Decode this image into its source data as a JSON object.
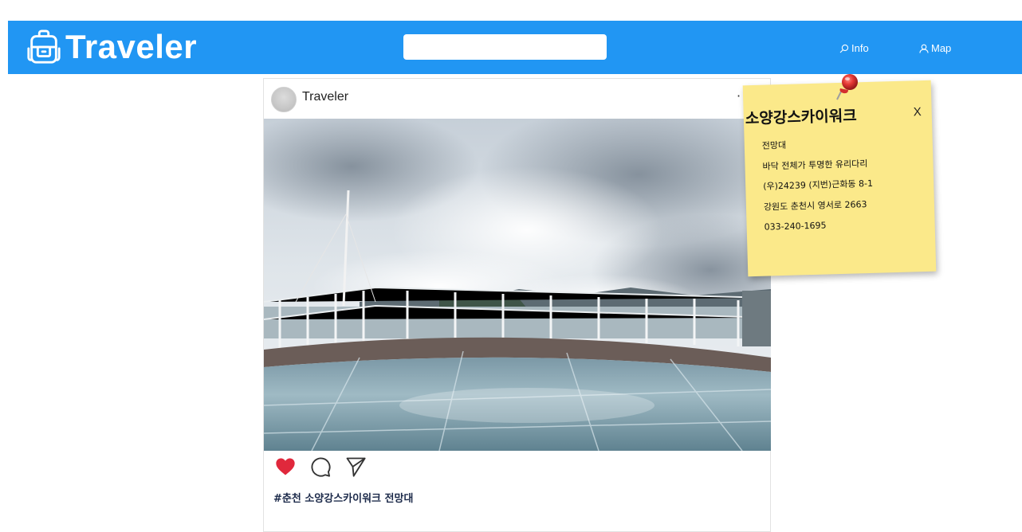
{
  "header": {
    "app_name": "Traveler",
    "search": {
      "value": "",
      "placeholder": ""
    },
    "nav": [
      {
        "label": "Info",
        "icon": "search-icon"
      },
      {
        "label": "Map",
        "icon": "person-icon"
      }
    ]
  },
  "post": {
    "username": "Traveler",
    "more_label": "·",
    "image_description_icon": "panorama-photo",
    "actions": [
      "heart-icon",
      "comment-icon",
      "send-icon"
    ],
    "caption": "#춘천 소양강스카이워크 전망대",
    "liked": true
  },
  "info_note": {
    "title": "소양강스카이워크",
    "close_label": "X",
    "lines": [
      "전망대",
      "바닥 전체가 투명한 유리다리",
      "(우)24239 (지번)근화동 8-1",
      "강원도 춘천시 영서로 2663",
      "033-240-1695"
    ]
  },
  "colors": {
    "navbar": "#2196f3",
    "note": "#fbe98a",
    "heart": "#e0283c",
    "pin": "#e53935"
  }
}
